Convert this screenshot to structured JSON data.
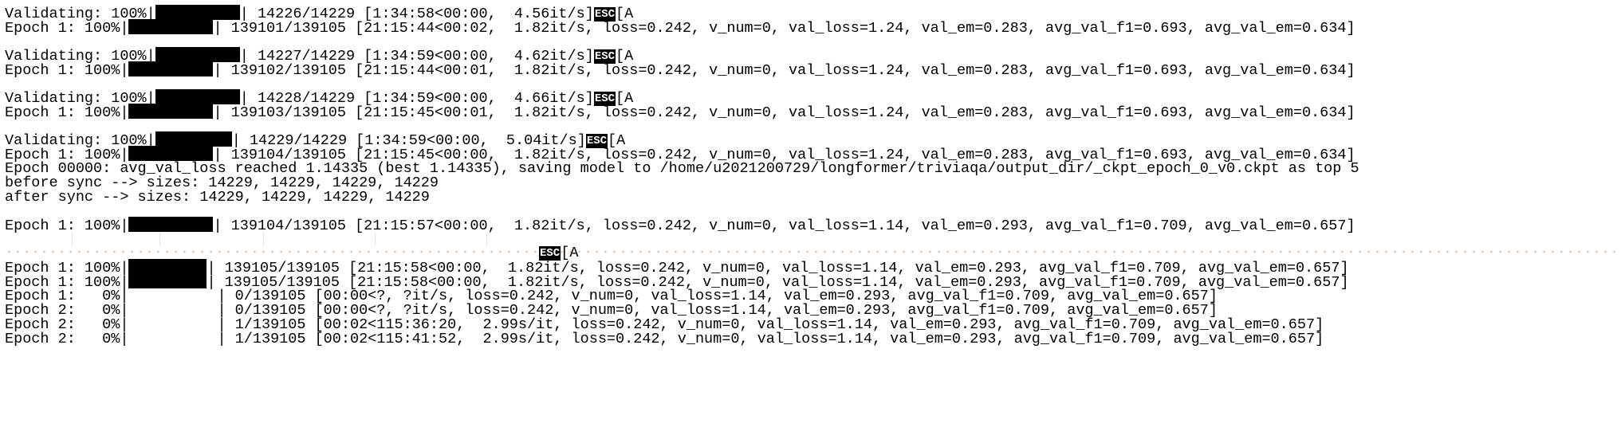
{
  "window": {
    "title": ""
  },
  "esc_glyph": "ESC",
  "esc_tail": "[A",
  "lines": [
    {
      "id": "l1",
      "pre": "Validating: 100%|",
      "post": "| 14226/14229 [1:34:58<00:00,  4.56it/s]",
      "esc": true
    },
    {
      "id": "l2",
      "pre": "Epoch 1: 100%|",
      "post": "| 139101/139105 [21:15:44<00:02,  1.82it/s, loss=0.242, v_num=0, val_loss=1.24, val_em=0.283, avg_val_f1=0.693, avg_val_em=0.634]",
      "esc": false
    },
    {
      "id": "l3",
      "pre": "Validating: 100%|",
      "post": "| 14227/14229 [1:34:59<00:00,  4.62it/s]",
      "esc": true
    },
    {
      "id": "l4",
      "pre": "Epoch 1: 100%|",
      "post": "| 139102/139105 [21:15:44<00:01,  1.82it/s, loss=0.242, v_num=0, val_loss=1.24, val_em=0.283, avg_val_f1=0.693, avg_val_em=0.634]",
      "esc": false
    },
    {
      "id": "l5",
      "pre": "Validating: 100%|",
      "post": "| 14228/14229 [1:34:59<00:00,  4.66it/s]",
      "esc": true
    },
    {
      "id": "l6",
      "pre": "Epoch 1: 100%|",
      "post": "| 139103/139105 [21:15:45<00:01,  1.82it/s, loss=0.242, v_num=0, val_loss=1.24, val_em=0.283, avg_val_f1=0.693, avg_val_em=0.634]",
      "esc": false
    },
    {
      "id": "l7",
      "pre": "Validating: 100%|",
      "post": "| 14229/14229 [1:34:59<00:00,  5.04it/s]",
      "esc": true
    },
    {
      "id": "l8",
      "pre": "Epoch 1: 100%|",
      "post": "| 139104/139105 [21:15:45<00:00,  1.82it/s, loss=0.242, v_num=0, val_loss=1.24, val_em=0.283, avg_val_f1=0.693, avg_val_em=0.634]",
      "esc": false
    },
    {
      "id": "l9",
      "text": "Epoch 00000: avg_val_loss reached 1.14335 (best 1.14335), saving model to /home/u2021200729/longformer/triviaqa/output_dir/_ckpt_epoch_0_v0.ckpt as top 5"
    },
    {
      "id": "l10",
      "text": "before sync --> sizes: 14229, 14229, 14229, 14229"
    },
    {
      "id": "l11",
      "text": "after sync --> sizes: 14229, 14229, 14229, 14229"
    },
    {
      "id": "l12",
      "pre": "Epoch 1: 100%|",
      "post": "| 139104/139105 [21:15:57<00:00,  1.82it/s, loss=0.242, v_num=0, val_loss=1.14, val_em=0.293, avg_val_f1=0.709, avg_val_em=0.657]",
      "esc": false
    },
    {
      "id": "l13",
      "escOnly": true
    },
    {
      "id": "l14",
      "pre": "Epoch 1: 100%|",
      "post": "| 139105/139105 [21:15:58<00:00,  1.82it/s, loss=0.242, v_num=0, val_loss=1.14, val_em=0.293, avg_val_f1=0.709, avg_val_em=0.657]",
      "esc": false
    },
    {
      "id": "l15",
      "pre": "Epoch 1: 100%|",
      "post": "| 139105/139105 [21:15:58<00:00,  1.82it/s, loss=0.242, v_num=0, val_loss=1.14, val_em=0.293, avg_val_f1=0.709, avg_val_em=0.657]",
      "esc": false
    },
    {
      "id": "l16",
      "text": "Epoch 1:   0%|          | 0/139105 [00:00<?, ?it/s, loss=0.242, v_num=0, val_loss=1.14, val_em=0.293, avg_val_f1=0.709, avg_val_em=0.657]"
    },
    {
      "id": "l17",
      "text": "Epoch 2:   0%|          | 0/139105 [00:00<?, ?it/s, loss=0.242, v_num=0, val_loss=1.14, val_em=0.293, avg_val_f1=0.709, avg_val_em=0.657]"
    },
    {
      "id": "l18",
      "text": "Epoch 2:   0%|          | 1/139105 [00:02<115:36:20,  2.99s/it, loss=0.242, v_num=0, val_loss=1.14, val_em=0.293, avg_val_f1=0.709, avg_val_em=0.657]"
    },
    {
      "id": "l19",
      "text": "Epoch 2:   0%|          | 1/139105 [00:02<115:41:52,  2.99s/it, loss=0.242, v_num=0, val_loss=1.14, val_em=0.293, avg_val_f1=0.709, avg_val_em=0.657]"
    }
  ]
}
